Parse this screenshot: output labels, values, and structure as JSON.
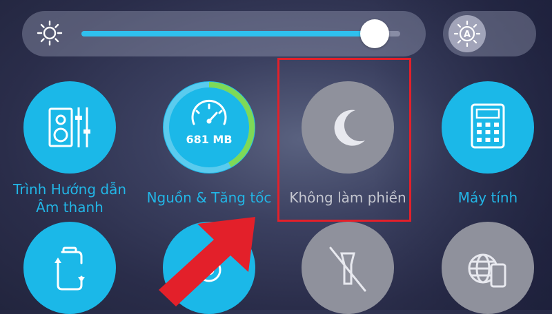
{
  "brightness": {
    "level_percent": 92
  },
  "tiles": [
    {
      "id": "sound",
      "label_line1": "Trình Hướng dẫn",
      "label_line2": "Âm thanh",
      "icon": "speaker-equalizer-icon"
    },
    {
      "id": "boost",
      "label": "Nguồn & Tăng tốc",
      "memory": "681 MB",
      "icon": "speedometer-icon",
      "ring_fill_fraction": 0.42
    },
    {
      "id": "dnd",
      "label": "Không làm phiền",
      "icon": "moon-icon",
      "state": "off"
    },
    {
      "id": "calc",
      "label": "Máy tính",
      "icon": "calculator-icon"
    },
    {
      "id": "rotate",
      "icon": "auto-rotate-icon"
    },
    {
      "id": "settings",
      "icon": "gear-icon"
    },
    {
      "id": "flashlight",
      "icon": "flashlight-off-icon"
    },
    {
      "id": "web",
      "icon": "globe-phone-icon"
    }
  ],
  "colors": {
    "accent": "#1bb8e8",
    "ring": "#7ed957",
    "highlight": "#e3202a",
    "arrow": "#e3202a"
  }
}
